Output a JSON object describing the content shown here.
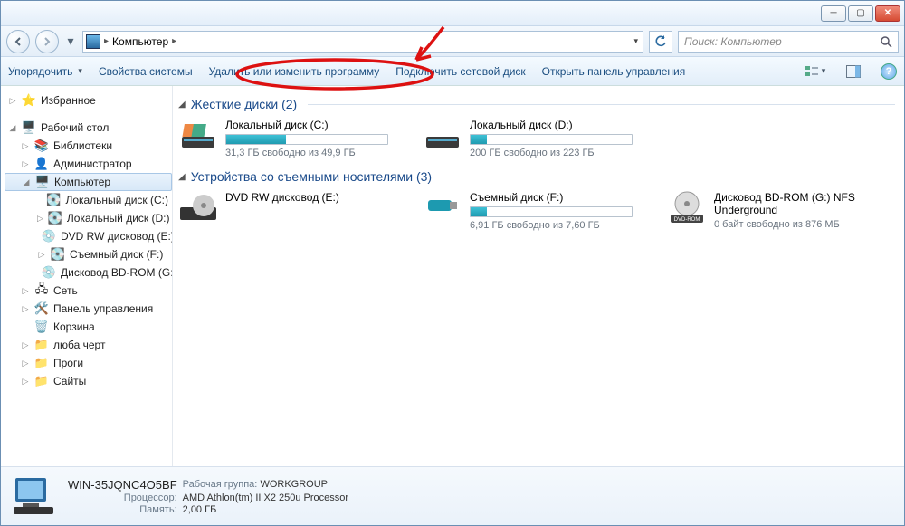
{
  "window": {
    "title": "Компьютер"
  },
  "nav": {
    "breadcrumb": [
      "Компьютер"
    ],
    "search_placeholder": "Поиск: Компьютер"
  },
  "toolbar": {
    "organize": "Упорядочить",
    "system_props": "Свойства системы",
    "uninstall": "Удалить или изменить программу",
    "map_drive": "Подключить сетевой диск",
    "control_panel": "Открыть панель управления"
  },
  "sidebar": {
    "favorites": "Избранное",
    "desktop": "Рабочий стол",
    "libraries": "Библиотеки",
    "admin": "Администратор",
    "computer": "Компьютер",
    "drive_c": "Локальный диск (C:)",
    "drive_d": "Локальный диск (D:)",
    "dvd": "DVD RW дисковод (E:)",
    "drive_f": "Съемный диск (F:)",
    "bdrom": "Дисковод BD-ROM (G:)",
    "network": "Сеть",
    "cpanel": "Панель управления",
    "recycle": "Корзина",
    "luba": "люба черт",
    "progi": "Проги",
    "sites": "Сайты"
  },
  "content": {
    "group_hdd": "Жесткие диски (2)",
    "group_removable": "Устройства со съемными носителями (3)",
    "drives": {
      "c": {
        "name": "Локальный диск (C:)",
        "info": "31,3 ГБ свободно из 49,9 ГБ",
        "fill_pct": 37
      },
      "d": {
        "name": "Локальный диск (D:)",
        "info": "200 ГБ свободно из 223 ГБ",
        "fill_pct": 10
      },
      "dvd": {
        "name": "DVD RW дисковод (E:)"
      },
      "f": {
        "name": "Съемный диск (F:)",
        "info": "6,91 ГБ свободно из 7,60 ГБ",
        "fill_pct": 10
      },
      "bdrom": {
        "name": "Дисковод BD-ROM (G:) NFS Underground",
        "info": "0 байт свободно из 876 МБ"
      }
    }
  },
  "details": {
    "title": "WIN-35JQNC4O5BF",
    "workgroup_label": "Рабочая группа:",
    "workgroup": "WORKGROUP",
    "cpu_label": "Процессор:",
    "cpu": "AMD Athlon(tm) II X2 250u Processor",
    "mem_label": "Память:",
    "mem": "2,00 ГБ"
  }
}
